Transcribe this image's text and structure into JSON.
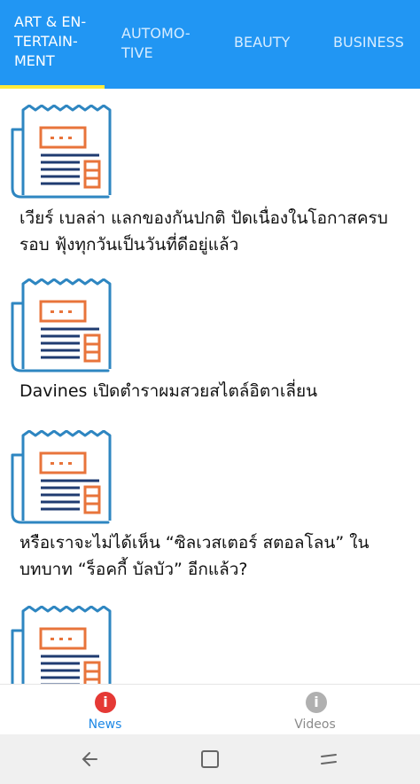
{
  "tabs": [
    {
      "label": "ART & EN-\nTERTAIN-\nMENT"
    },
    {
      "label": "AUTOMO-\nTIVE"
    },
    {
      "label": "BEAUTY"
    },
    {
      "label": "BUSINESS"
    }
  ],
  "colors": {
    "primary": "#2196f3",
    "indicator": "#ffeb3b",
    "news_active": "#e53935",
    "inactive_gray": "#a0a0a0",
    "thumb_blue": "#2e86c1",
    "thumb_orange": "#e8743b",
    "thumb_navy": "#1f3b70"
  },
  "articles": [
    {
      "title": "เวียร์ เบลล่า แลกของกันปกติ ปัดเนื่องในโอกาสครบรอบ ฟุ้งทุกวันเป็นวันที่ดีอยู่แล้ว",
      "icon": "newspaper-icon"
    },
    {
      "title": "Davines เปิดตำราผมสวยสไตล์อิตาเลี่ยน",
      "icon": "newspaper-icon"
    },
    {
      "title": "หรือเราจะไม่ได้เห็น “ซิลเวสเตอร์ สตอลโลน” ในบทบาท “ร็อคกี้ บัลบัว” อีกแล้ว?",
      "icon": "newspaper-icon"
    },
    {
      "title": "",
      "icon": "newspaper-icon"
    }
  ],
  "bottom_nav": [
    {
      "label": "News",
      "icon": "info-icon",
      "glyph": "i",
      "active": true
    },
    {
      "label": "Videos",
      "icon": "info-icon",
      "glyph": "i",
      "active": false
    }
  ],
  "system_nav": [
    "back-icon",
    "recents-icon",
    "home-icon"
  ]
}
